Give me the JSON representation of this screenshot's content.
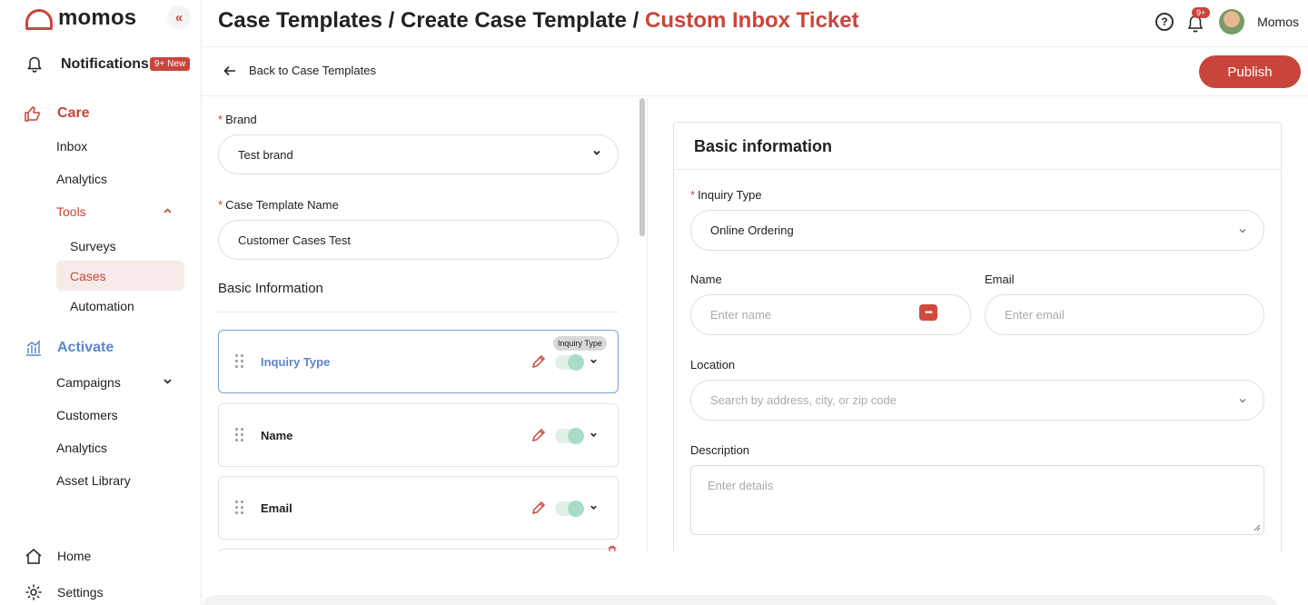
{
  "brand": {
    "name": "momos",
    "color": "#c9453b"
  },
  "sidebar": {
    "collapse_label": "«",
    "notifications": {
      "label": "Notifications",
      "badge": "9+ New"
    },
    "care": {
      "label": "Care",
      "items": [
        "Inbox",
        "Analytics"
      ],
      "tools": {
        "label": "Tools",
        "items": [
          "Surveys",
          "Cases",
          "Automation"
        ]
      }
    },
    "activate": {
      "label": "Activate",
      "items": [
        "Campaigns",
        "Customers",
        "Analytics",
        "Asset Library"
      ]
    },
    "home": "Home",
    "settings": "Settings"
  },
  "header": {
    "crumb1": "Case Templates",
    "sep": " / ",
    "crumb2": "Create Case Template",
    "crumb3": "Custom Inbox Ticket",
    "help": "?",
    "notif_count": "9+",
    "user": "Momos"
  },
  "subheader": {
    "back_label": "Back to Case Templates",
    "publish_label": "Publish"
  },
  "form": {
    "brand_label": "Brand",
    "brand_value": "Test brand",
    "template_name_label": "Case Template Name",
    "template_name_value": "Customer Cases Test",
    "section_label": "Basic Information",
    "fields": [
      {
        "name": "Inquiry Type",
        "tooltip": "Inquiry Type"
      },
      {
        "name": "Name"
      },
      {
        "name": "Email"
      }
    ]
  },
  "preview": {
    "title": "Basic information",
    "inquiry_label": "Inquiry Type",
    "inquiry_value": "Online Ordering",
    "name_label": "Name",
    "name_placeholder": "Enter name",
    "email_label": "Email",
    "email_placeholder": "Enter email",
    "location_label": "Location",
    "location_placeholder": "Search by address, city, or zip code",
    "description_label": "Description",
    "description_placeholder": "Enter details",
    "pwd_icon_text": "•••"
  }
}
